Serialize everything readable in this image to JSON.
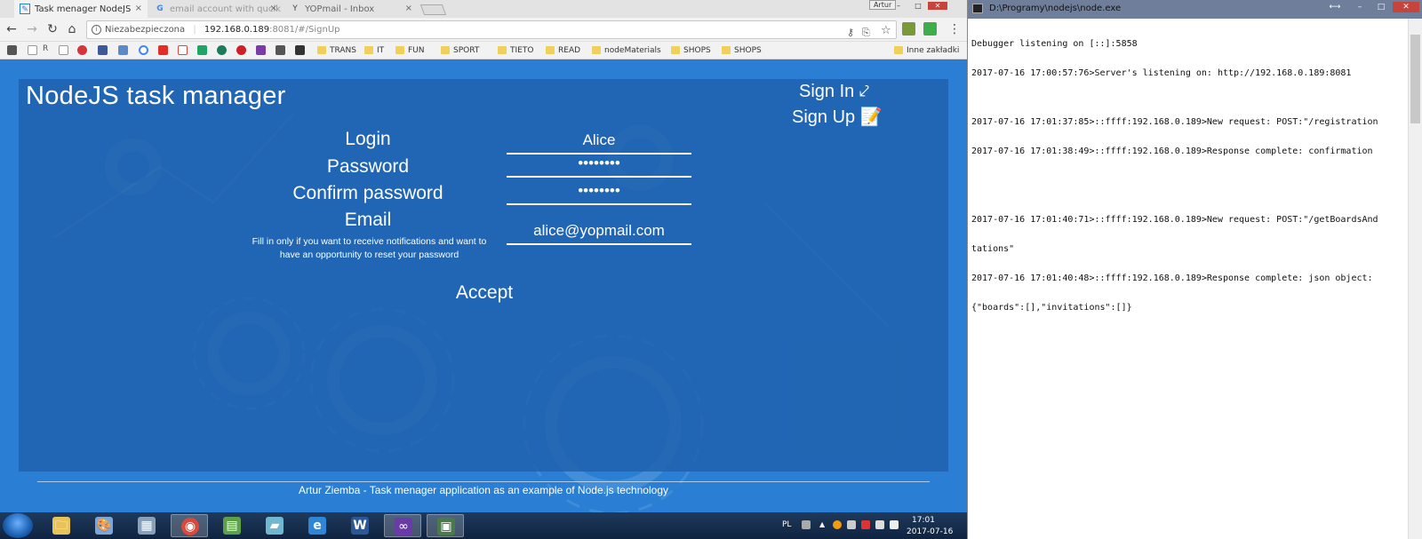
{
  "browser": {
    "tabs": [
      {
        "title": "Task menager NodeJS",
        "close": "×"
      },
      {
        "title": "email account with qucik",
        "close": "×"
      },
      {
        "title": "YOPmail - Inbox",
        "close": "×"
      }
    ],
    "user_badge": "Artur",
    "window_controls": {
      "minimize": "–",
      "maximize": "□",
      "close": "✕"
    },
    "nav": {
      "back": "←",
      "forward": "→",
      "reload": "↻",
      "home": "⌂",
      "menu": "⋮"
    },
    "address": {
      "info": "i",
      "security_label": "Niezabezpieczona",
      "host": "192.168.0.189",
      "rest": ":8081/#/SignUp"
    },
    "omnibox_icons": {
      "key": "⚷",
      "translate": "⎘",
      "star": "☆"
    },
    "bookmarks": {
      "letter": "R",
      "folders": [
        "TRANS",
        "IT",
        "FUN",
        "SPORT",
        "TIETO",
        "READ",
        "nodeMaterials",
        "SHOPS",
        "SHOPS"
      ],
      "other": "Inne zakładki"
    }
  },
  "app": {
    "title": "NodeJS task manager",
    "signin_label": "Sign In ⤦",
    "signup_label": "Sign Up 📝",
    "form": {
      "login_label": "Login",
      "login_value": "Alice",
      "password_label": "Password",
      "password_value": "password",
      "confirm_label": "Confirm password",
      "confirm_value": "password",
      "email_label": "Email",
      "email_hint": "Fill in only if you want to receive notifications and want to have an opportunity to reset your password",
      "email_value": "alice@yopmail.com",
      "accept_label": "Accept"
    },
    "footer": "Artur Ziemba - Task menager application as an example of Node.js technology"
  },
  "console": {
    "title": "D:\\Programy\\nodejs\\node.exe",
    "controls": {
      "resize": "⟷",
      "minimize": "–",
      "maximize": "□",
      "close": "✕"
    },
    "lines": [
      "Debugger listening on [::]:5858",
      "2017-07-16 17:00:57:76>Server's listening on: http://192.168.0.189:8081",
      "",
      "2017-07-16 17:01:37:85>::ffff:192.168.0.189>New request: POST:\"/registration",
      "2017-07-16 17:01:38:49>::ffff:192.168.0.189>Response complete: confirmation",
      "",
      "",
      "2017-07-16 17:01:40:71>::ffff:192.168.0.189>New request: POST:\"/getBoardsAnd",
      "tations\"",
      "2017-07-16 17:01:40:48>::ffff:192.168.0.189>Response complete: json object:",
      "{\"boards\":[],\"invitations\":[]}"
    ]
  },
  "taskbar": {
    "language": "PL",
    "time": "17:01",
    "date": "2017-07-16",
    "apps": [
      {
        "name": "explorer",
        "glyph": "🗀",
        "color": "#e8c35a"
      },
      {
        "name": "paint",
        "glyph": "🎨",
        "color": "#7ca6d8"
      },
      {
        "name": "calculator",
        "glyph": "▦",
        "color": "#8aa0b8"
      },
      {
        "name": "chrome",
        "glyph": "◉",
        "color": "#d94a3a"
      },
      {
        "name": "project",
        "glyph": "▤",
        "color": "#5ea04a"
      },
      {
        "name": "notes",
        "glyph": "▰",
        "color": "#6fb8d0"
      },
      {
        "name": "internet-explorer",
        "glyph": "e",
        "color": "#2f86d6"
      },
      {
        "name": "word",
        "glyph": "W",
        "color": "#2b5797"
      },
      {
        "name": "visual-studio",
        "glyph": "∞",
        "color": "#6a3aa8"
      },
      {
        "name": "console",
        "glyph": "▣",
        "color": "#4a7a4a"
      }
    ]
  }
}
